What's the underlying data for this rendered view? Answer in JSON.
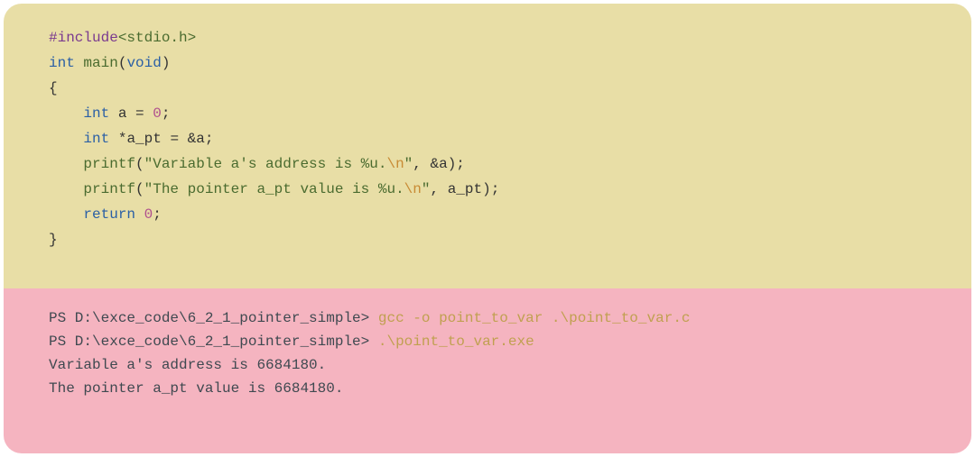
{
  "code": {
    "include_directive": "#include",
    "include_header": "<stdio.h>",
    "kw_int": "int",
    "kw_void": "void",
    "kw_return": "return",
    "fn_main": "main",
    "fn_printf": "printf",
    "var_a": "a",
    "var_apt": "a_pt",
    "num_zero": "0",
    "str1_part1": "\"Variable a's address is %u.",
    "str1_esc": "\\n",
    "str1_part2": "\"",
    "str2_part1": "\"The pointer a_pt value is %u.",
    "str2_esc": "\\n",
    "str2_part2": "\"",
    "amp_a": "&a",
    "star": "*",
    "eq": " = ",
    "semi": ";",
    "lbrace": "{",
    "rbrace": "}",
    "lparen": "(",
    "rparen": ")",
    "comma": ", ",
    "indent": "    "
  },
  "terminal": {
    "prompt": "PS D:\\exce_code\\6_2_1_pointer_simple> ",
    "cmd1": "gcc -o point_to_var .\\point_to_var.c",
    "cmd2": ".\\point_to_var.exe",
    "out1": "Variable a's address is 6684180.",
    "out2": "The pointer a_pt value is 6684180."
  }
}
